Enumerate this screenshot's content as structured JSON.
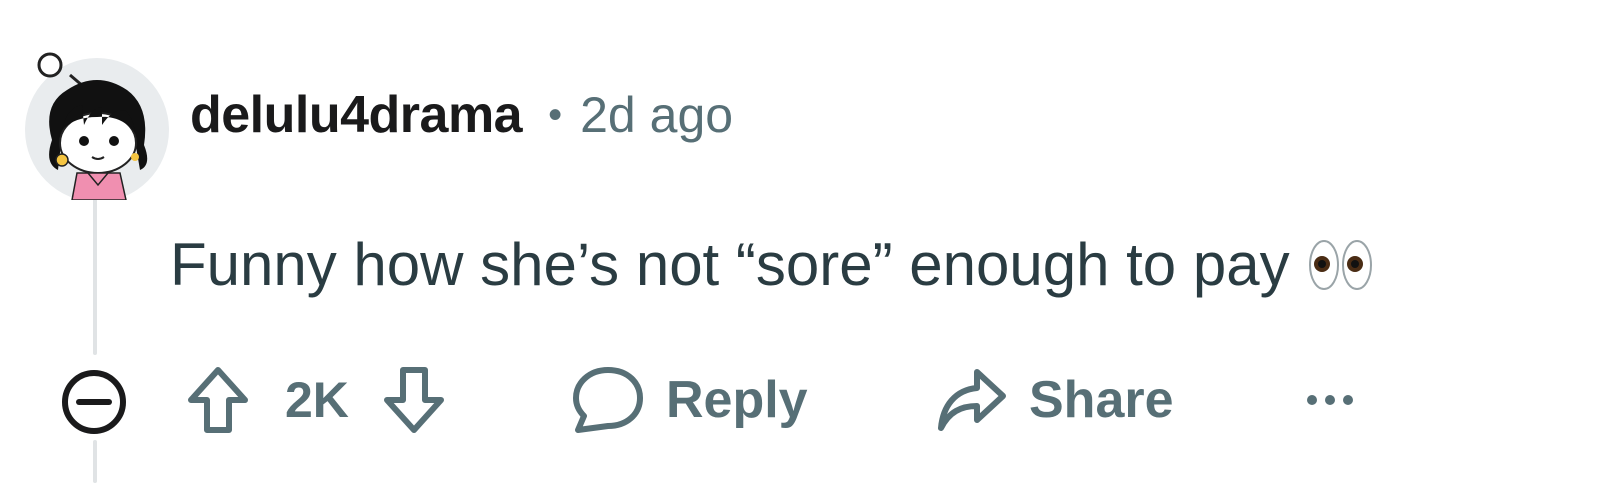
{
  "comment": {
    "username": "delulu4drama",
    "separator": "•",
    "time_ago": "2d ago",
    "text": "Funny how she’s not “sore” enough to pay",
    "emoji_icon": "eyes-emoji-icon"
  },
  "actions": {
    "vote_count": "2K",
    "reply_label": "Reply",
    "share_label": "Share"
  },
  "colors": {
    "username": "#1a1a1b",
    "meta": "#576f76",
    "body": "#2a3c42",
    "thread_line": "#e0e3e5"
  }
}
